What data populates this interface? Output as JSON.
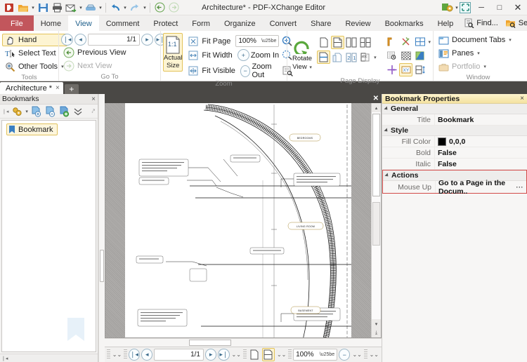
{
  "window": {
    "title": "Architecture* - PDF-XChange Editor",
    "minimize": "─",
    "maximize": "□",
    "close": "✕"
  },
  "quick_access": {
    "icons": [
      "app-logo-icon",
      "open-icon",
      "save-icon",
      "print-icon",
      "email-icon",
      "scan-icon",
      "undo-icon",
      "redo-icon",
      "back-icon",
      "forward-icon"
    ],
    "customize_icon": "customize-quick-access-icon"
  },
  "menu": {
    "tabs": [
      {
        "label": "File",
        "active": false,
        "kind": "file"
      },
      {
        "label": "Home",
        "active": false
      },
      {
        "label": "View",
        "active": true
      },
      {
        "label": "Comment",
        "active": false
      },
      {
        "label": "Protect",
        "active": false
      },
      {
        "label": "Form",
        "active": false
      },
      {
        "label": "Organize",
        "active": false
      },
      {
        "label": "Convert",
        "active": false
      },
      {
        "label": "Share",
        "active": false
      },
      {
        "label": "Review",
        "active": false
      },
      {
        "label": "Bookmarks",
        "active": false
      },
      {
        "label": "Help",
        "active": false
      }
    ],
    "find_label": "Find...",
    "search_label": "Search...",
    "collapse_ribbon": "˄"
  },
  "ribbon": {
    "groups": [
      {
        "name": "Tools",
        "label": "Tools",
        "items": [
          {
            "label": "Hand",
            "icon": "hand-icon",
            "selected": true
          },
          {
            "label": "Select Text",
            "icon": "select-text-icon",
            "selected": false
          },
          {
            "label": "Other Tools",
            "icon": "other-tools-icon",
            "selected": false,
            "dropdown": true
          }
        ]
      },
      {
        "name": "Go To",
        "label": "Go To",
        "page_value": "1/1",
        "first_page_icon": "first-page-icon",
        "prev_page_icon": "previous-page-icon",
        "next_page_icon": "next-page-icon",
        "last_page_icon": "last-page-icon",
        "items": [
          {
            "label": "Previous View",
            "icon": "previous-view-icon",
            "disabled": false
          },
          {
            "label": "Next View",
            "icon": "next-view-icon",
            "disabled": true
          }
        ]
      },
      {
        "name": "Zoom",
        "label": "Zoom",
        "actual_size": {
          "label_line1": "Actual",
          "label_line2": "Size",
          "badge": "1:1"
        },
        "zoom_value": "100%",
        "items": [
          {
            "label": "Fit Page",
            "icon": "fit-page-icon"
          },
          {
            "label": "Fit Width",
            "icon": "fit-width-icon"
          },
          {
            "label": "Fit Visible",
            "icon": "fit-visible-icon"
          },
          {
            "label": "Zoom In",
            "icon": "zoom-in-icon"
          },
          {
            "label": "Zoom Out",
            "icon": "zoom-out-icon"
          }
        ],
        "right_icons": [
          "magnifier-icon",
          "loupe-icon",
          "pan-and-zoom-icon"
        ]
      },
      {
        "name": "Page Display",
        "label": "Page Display",
        "rotate": {
          "line1": "Rotate",
          "line2": "View",
          "icon": "rotate-view-icon"
        },
        "icons_row1": [
          "single-page-icon",
          "single-page-continuous-icon",
          "two-pages-icon",
          "two-pages-continuous-icon"
        ],
        "icons_row2": [
          "split-view-icon",
          "cover-page-icon",
          "page-numbers-icon",
          "page-transitions-icon"
        ],
        "icons_row3": [
          "rulers-icon",
          "guides-icon",
          "grid-icon"
        ],
        "icons_row4": [
          "snap-icon",
          "measurement-icon",
          "auto-scroll-icon"
        ]
      },
      {
        "name": "Window",
        "label": "Window",
        "items": [
          {
            "label": "Document Tabs",
            "icon": "document-tabs-icon",
            "dropdown": true,
            "disabled": false
          },
          {
            "label": "Panes",
            "icon": "panes-icon",
            "dropdown": true,
            "disabled": false
          },
          {
            "label": "Portfolio",
            "icon": "portfolio-icon",
            "dropdown": true,
            "disabled": true
          }
        ]
      }
    ]
  },
  "document_tabs": {
    "tabs": [
      {
        "label": "Architecture *",
        "close": "×"
      }
    ],
    "new_tab": "+"
  },
  "bookmarks_pane": {
    "title": "Bookmarks",
    "close": "×",
    "toolbar_icons": [
      "options-gear-icon",
      "new-bookmark-icon",
      "delete-bookmark-icon",
      "add-bookmark-icon",
      "expand-all-icon"
    ],
    "items": [
      {
        "label": "Bookmark",
        "icon": "bookmark-icon",
        "selected": true
      }
    ],
    "watermark_icon": "bookmark-watermark-icon"
  },
  "document": {
    "close": "✕",
    "rooms": [
      "BEDROOMS",
      "LIVING ROOM",
      "BASEMENT"
    ],
    "bottom_bar": {
      "page_value": "1/1",
      "zoom_value": "100%",
      "first_page_icon": "first-page-icon",
      "prev_page_icon": "previous-page-icon",
      "next_page_icon": "next-page-icon",
      "last_page_icon": "last-page-icon",
      "single_page_icon": "single-page-icon",
      "continuous_icon": "continuous-page-icon",
      "zoom_out_icon": "zoom-out-icon"
    }
  },
  "properties_pane": {
    "title": "Bookmark Properties",
    "close": "×",
    "sections": [
      {
        "name": "General",
        "label": "General",
        "rows": [
          {
            "label": "Title",
            "value": "Bookmark",
            "type": "text"
          }
        ]
      },
      {
        "name": "Style",
        "label": "Style",
        "rows": [
          {
            "label": "Fill Color",
            "value": "0,0,0",
            "type": "color",
            "color": "#000000"
          },
          {
            "label": "Bold",
            "value": "False",
            "type": "text"
          },
          {
            "label": "Italic",
            "value": "False",
            "type": "text"
          }
        ]
      },
      {
        "name": "Actions",
        "label": "Actions",
        "highlighted": true,
        "rows": [
          {
            "label": "Mouse Up",
            "value": "Go to a Page in the Docum..",
            "type": "text",
            "more": "⋯"
          }
        ]
      }
    ]
  },
  "colors": {
    "file_tab": "#c2565c",
    "ribbon_selected": "#fdf4d2",
    "ribbon_selected_border": "#e3c35a",
    "pane_header": "#f4e2a0",
    "highlight_border": "#d24a48",
    "doc_chrome": "#4a4845"
  }
}
